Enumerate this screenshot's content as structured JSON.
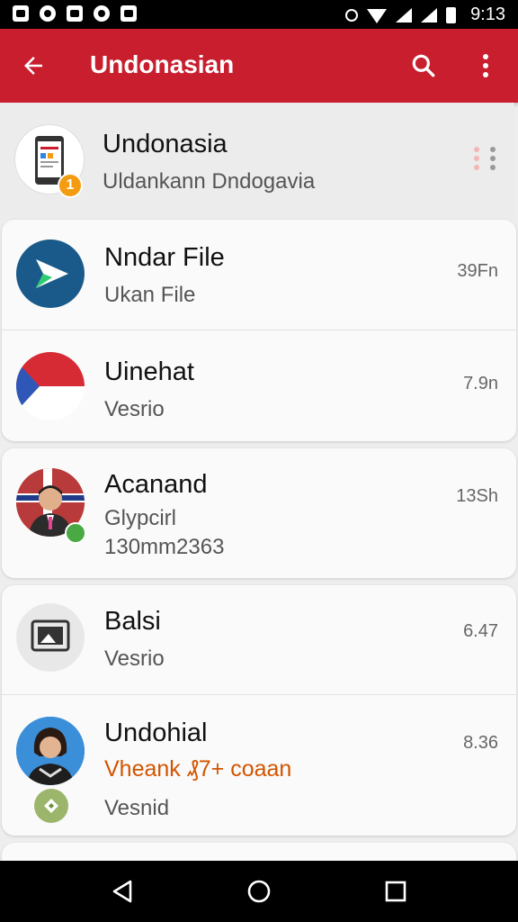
{
  "status_bar": {
    "time": "9:13",
    "left_icons": [
      "photo-icon",
      "blocked-icon",
      "mountain-icon",
      "chat-icon",
      "card-icon"
    ],
    "right_icons": [
      "alarm-icon",
      "wifi-icon",
      "signal-icon",
      "signal-icon",
      "battery-icon"
    ]
  },
  "app_bar": {
    "title": "Undonasian",
    "back_icon": "arrow-left-icon",
    "search_icon": "search-icon",
    "overflow_icon": "more-vert-icon",
    "color": "#c81e2e"
  },
  "items": [
    {
      "title": "Undonasia",
      "subtitle": "Uldankann Dndogavia",
      "badge": "1",
      "selected": true
    },
    {
      "title": "Nndar File",
      "subtitle": "Ukan File",
      "meta": "39Fn"
    },
    {
      "title": "Uinehat",
      "subtitle": "Vesrio",
      "meta": "7.9n"
    },
    {
      "title": "Acanand",
      "subtitle": "Glypcirl",
      "subtitle2": "130mm2363",
      "meta": "13Sh"
    },
    {
      "title": "Balsi",
      "subtitle": "Vesrio",
      "meta": "6.47"
    },
    {
      "title": "Undohial",
      "accent_line": "Vheank ₰7+ coaan",
      "subtitle": "Vesnid",
      "meta": "8.36"
    }
  ],
  "nav_bar": {
    "back_icon": "nav-back-icon",
    "home_icon": "nav-home-icon",
    "recents_icon": "nav-recents-icon"
  }
}
